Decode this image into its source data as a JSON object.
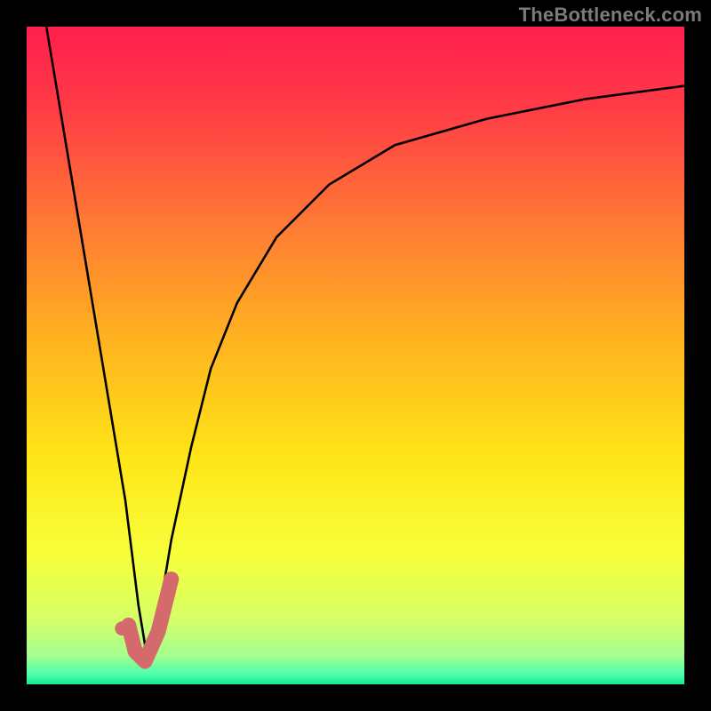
{
  "watermark": {
    "text": "TheBottleneck.com"
  },
  "colors": {
    "background": "#000000",
    "gradient_stops": [
      {
        "offset": 0.0,
        "color": "#ff1f4e"
      },
      {
        "offset": 0.12,
        "color": "#ff3a46"
      },
      {
        "offset": 0.3,
        "color": "#ff7a34"
      },
      {
        "offset": 0.48,
        "color": "#ffb41f"
      },
      {
        "offset": 0.66,
        "color": "#ffe618"
      },
      {
        "offset": 0.8,
        "color": "#f7ff3a"
      },
      {
        "offset": 0.9,
        "color": "#d6ff66"
      },
      {
        "offset": 0.955,
        "color": "#a6ff8f"
      },
      {
        "offset": 0.985,
        "color": "#4dffad"
      },
      {
        "offset": 1.0,
        "color": "#17e88f"
      }
    ],
    "curve": "#000000",
    "marker": "#d46a6b"
  },
  "chart_data": {
    "type": "line",
    "title": "",
    "xlabel": "",
    "ylabel": "",
    "xlim": [
      0,
      100
    ],
    "ylim": [
      0,
      100
    ],
    "grid": false,
    "series": [
      {
        "name": "left-branch",
        "x": [
          3,
          5,
          7,
          9,
          11,
          13,
          15,
          16,
          17,
          18
        ],
        "y": [
          100,
          88,
          76,
          64,
          52,
          40,
          28,
          20,
          12,
          6
        ]
      },
      {
        "name": "right-branch",
        "x": [
          18,
          20,
          22,
          25,
          28,
          32,
          38,
          46,
          56,
          70,
          85,
          100
        ],
        "y": [
          4,
          10,
          22,
          36,
          48,
          58,
          68,
          76,
          82,
          86,
          89,
          91
        ]
      }
    ],
    "marker_path": {
      "name": "check-marker",
      "x": [
        15.5,
        16.5,
        18,
        20,
        22
      ],
      "y": [
        9,
        5,
        3.5,
        8,
        16
      ]
    },
    "marker_dot": {
      "x": 14.5,
      "y": 8.5
    }
  }
}
